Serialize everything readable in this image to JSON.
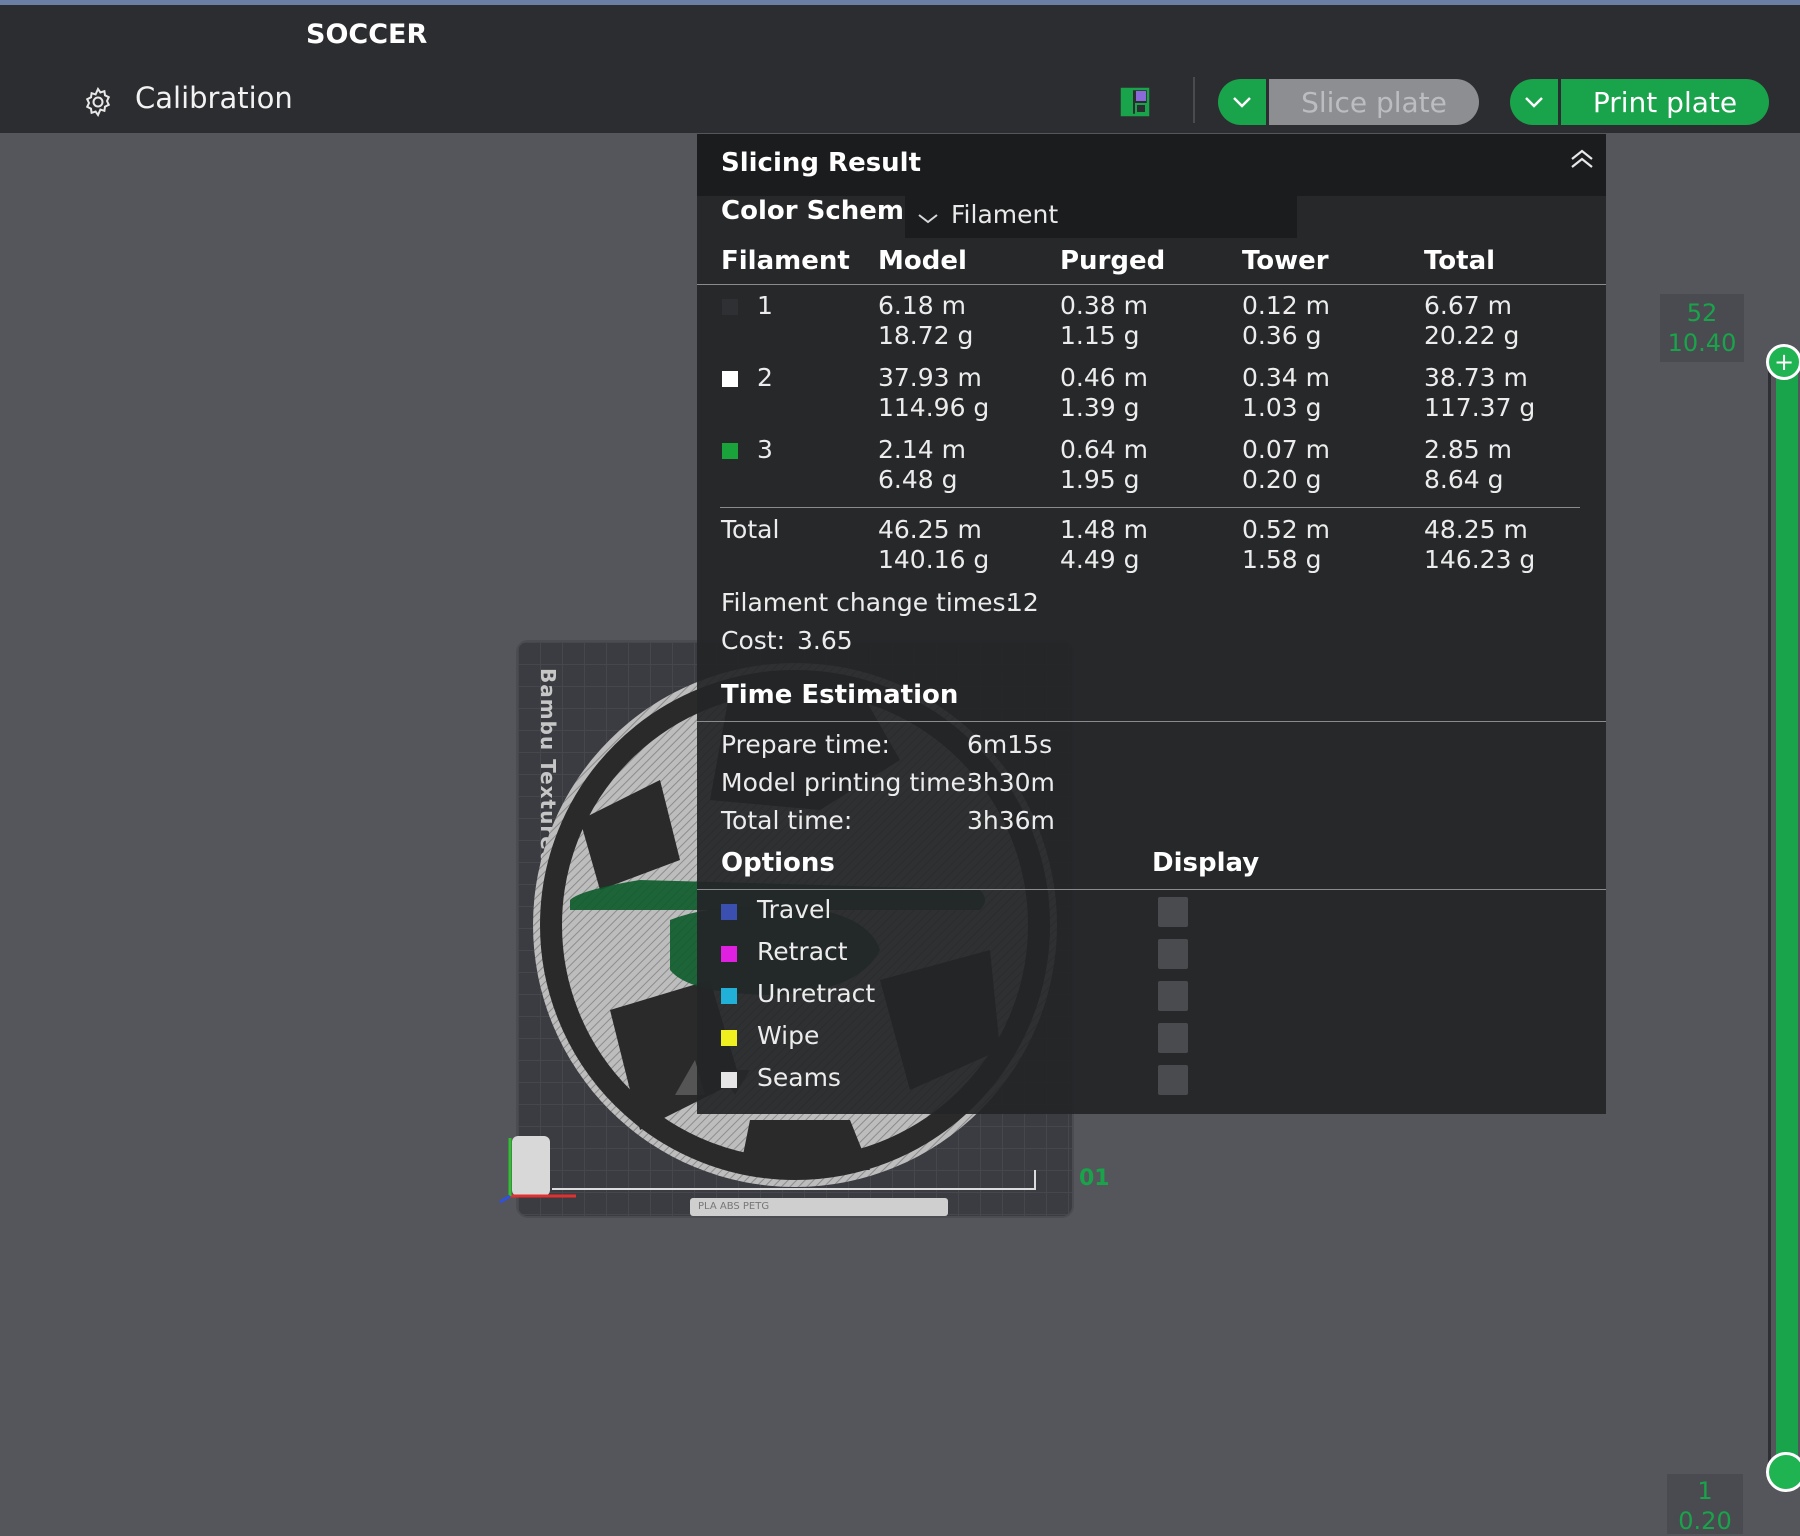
{
  "window": {
    "project_title": "SOCCER"
  },
  "toolbar": {
    "calibration_label": "Calibration",
    "slice_label": "Slice plate",
    "print_label": "Print plate"
  },
  "plate": {
    "label": "Bambu Textured P",
    "number": "01",
    "tab_text": "PLA ABS PETG"
  },
  "layer_slider": {
    "top_layer": "52",
    "top_height": "10.40",
    "bottom_layer": "1",
    "bottom_height": "0.20"
  },
  "slicing_result": {
    "title": "Slicing Result",
    "color_scheme_label": "Color Scheme",
    "color_scheme_value": "Filament",
    "columns": [
      "Filament",
      "Model",
      "Purged",
      "Tower",
      "Total"
    ],
    "rows": [
      {
        "id": "1",
        "color": "#2f3033",
        "model_m": "6.18 m",
        "model_g": "18.72 g",
        "purged_m": "0.38 m",
        "purged_g": "1.15 g",
        "tower_m": "0.12 m",
        "tower_g": "0.36 g",
        "total_m": "6.67 m",
        "total_g": "20.22 g"
      },
      {
        "id": "2",
        "color": "#ffffff",
        "model_m": "37.93 m",
        "model_g": "114.96 g",
        "purged_m": "0.46 m",
        "purged_g": "1.39 g",
        "tower_m": "0.34 m",
        "tower_g": "1.03 g",
        "total_m": "38.73 m",
        "total_g": "117.37 g"
      },
      {
        "id": "3",
        "color": "#1aa33a",
        "model_m": "2.14 m",
        "model_g": "6.48 g",
        "purged_m": "0.64 m",
        "purged_g": "1.95 g",
        "tower_m": "0.07 m",
        "tower_g": "0.20 g",
        "total_m": "2.85 m",
        "total_g": "8.64 g"
      }
    ],
    "total": {
      "label": "Total",
      "model_m": "46.25 m",
      "model_g": "140.16 g",
      "purged_m": "1.48 m",
      "purged_g": "4.49 g",
      "tower_m": "0.52 m",
      "tower_g": "1.58 g",
      "total_m": "48.25 m",
      "total_g": "146.23 g"
    },
    "filament_change_label": "Filament change times:",
    "filament_change_value": "12",
    "cost_label": "Cost:",
    "cost_value": "3.65"
  },
  "time_estimation": {
    "title": "Time Estimation",
    "prepare_label": "Prepare time:",
    "prepare_value": "6m15s",
    "model_print_label": "Model printing time:",
    "model_print_value": "3h30m",
    "total_label": "Total time:",
    "total_value": "3h36m"
  },
  "options": {
    "title": "Options",
    "display_title": "Display",
    "items": [
      {
        "label": "Travel",
        "color": "#3a4fb0"
      },
      {
        "label": "Retract",
        "color": "#e020e0"
      },
      {
        "label": "Unretract",
        "color": "#20b0d8"
      },
      {
        "label": "Wipe",
        "color": "#f0f020"
      },
      {
        "label": "Seams",
        "color": "#e6e6e6"
      }
    ]
  },
  "icons": {
    "calibration": "gear-icon",
    "layout": "layout-icon",
    "dropdown": "chevron-down-icon",
    "collapse": "double-chevron-up-icon"
  }
}
